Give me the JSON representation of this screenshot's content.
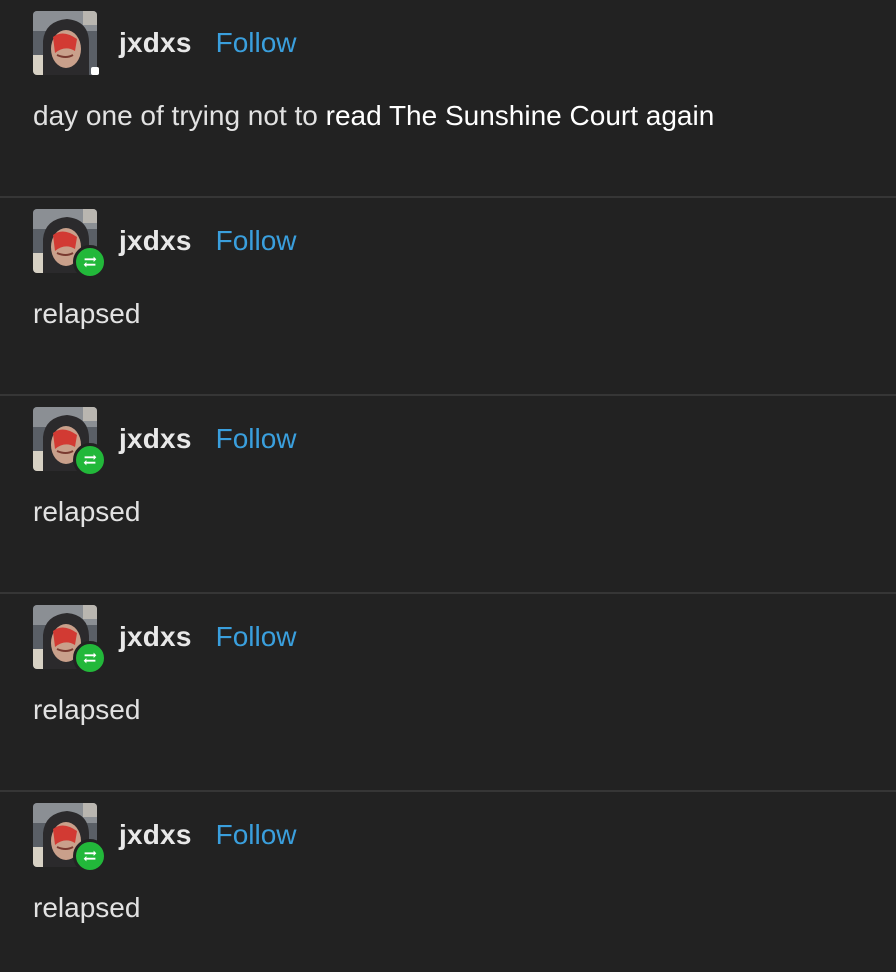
{
  "posts": [
    {
      "username": "jxdxs",
      "follow_label": "Follow",
      "text_part1": "day one of trying not to ",
      "text_part2": "read The Sunshine Court again",
      "reblogged": false
    },
    {
      "username": "jxdxs",
      "follow_label": "Follow",
      "text": "relapsed",
      "reblogged": true
    },
    {
      "username": "jxdxs",
      "follow_label": "Follow",
      "text": "relapsed",
      "reblogged": true
    },
    {
      "username": "jxdxs",
      "follow_label": "Follow",
      "text": "relapsed",
      "reblogged": true
    },
    {
      "username": "jxdxs",
      "follow_label": "Follow",
      "text": "relapsed",
      "reblogged": true
    }
  ],
  "colors": {
    "background": "#222222",
    "divider": "#363636",
    "follow_link": "#3a9fdd",
    "reblog_badge": "#22b83a"
  },
  "icons": {
    "reblog": "reblog-icon",
    "avatar": "avatar"
  }
}
